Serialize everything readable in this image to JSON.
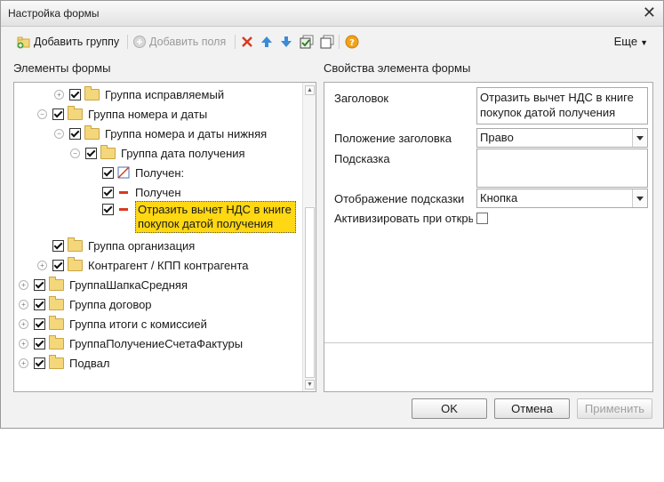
{
  "window": {
    "title": "Настройка формы"
  },
  "toolbar": {
    "add_group_label": "Добавить группу",
    "add_fields_label": "Добавить поля",
    "more_label": "Еще"
  },
  "left_panel": {
    "heading": "Элементы формы",
    "tree": [
      {
        "label": "Группа исправляемый",
        "expander": "plus",
        "checked": true,
        "icon": "folder"
      },
      {
        "label": "Группа номера и даты",
        "expander": "minus",
        "checked": true,
        "icon": "folder"
      },
      {
        "label": "Группа номера и даты нижняя",
        "expander": "minus",
        "checked": true,
        "icon": "folder"
      },
      {
        "label": "Группа дата получения",
        "expander": "minus",
        "checked": true,
        "icon": "folder"
      },
      {
        "label": "Получен:",
        "expander": "none",
        "checked": true,
        "icon": "field"
      },
      {
        "label": "Получен",
        "expander": "none",
        "checked": true,
        "icon": "field-minus"
      },
      {
        "label": "Отразить вычет НДС в книге покупок датой получения",
        "expander": "none",
        "checked": true,
        "icon": "field-minus",
        "selected": true
      },
      {
        "label": "Группа организация",
        "expander": "none",
        "checked": true,
        "icon": "folder"
      },
      {
        "label": "Контрагент / КПП контрагента",
        "expander": "plus",
        "checked": true,
        "icon": "folder"
      },
      {
        "label": "ГруппаШапкаСредняя",
        "expander": "plus",
        "checked": true,
        "icon": "folder"
      },
      {
        "label": "Группа договор",
        "expander": "plus",
        "checked": true,
        "icon": "folder"
      },
      {
        "label": "Группа итоги с комиссией",
        "expander": "plus",
        "checked": true,
        "icon": "folder"
      },
      {
        "label": "ГруппаПолучениеСчетаФактуры",
        "expander": "plus",
        "checked": true,
        "icon": "folder"
      },
      {
        "label": "Подвал",
        "expander": "plus",
        "checked": true,
        "icon": "folder"
      }
    ]
  },
  "right_panel": {
    "heading": "Свойства элемента формы",
    "title_label": "Заголовок",
    "title_value": "Отразить вычет НДС в книге покупок датой получения",
    "title_position_label": "Положение заголовка",
    "title_position_value": "Право",
    "hint_label": "Подсказка",
    "hint_value": "",
    "hint_display_label": "Отображение подсказки",
    "hint_display_value": "Кнопка",
    "activate_label": "Активизировать при откры",
    "activate_checked": false
  },
  "buttons": {
    "ok": "OK",
    "cancel": "Отмена",
    "apply": "Применить"
  }
}
